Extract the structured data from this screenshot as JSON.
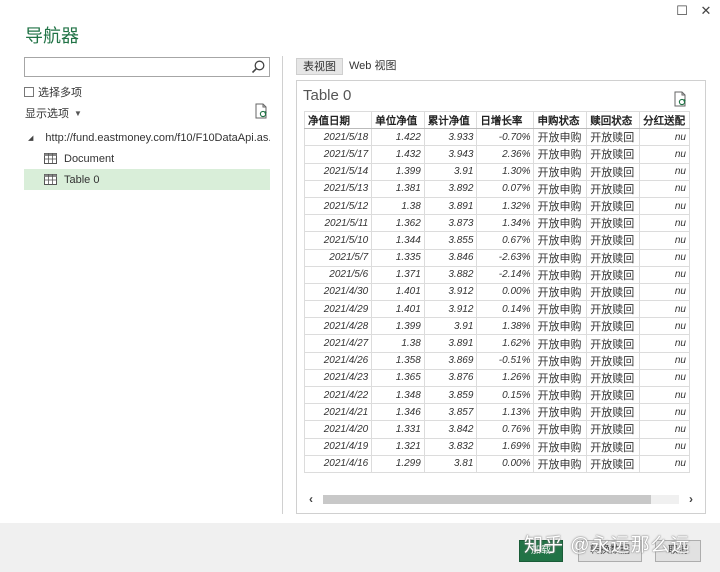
{
  "window": {
    "maximize_glyph": "☐",
    "close_glyph": "✕"
  },
  "title": "导航器",
  "search": {
    "value": "",
    "placeholder": ""
  },
  "select_multiple_label": "选择多项",
  "display_options_label": "显示选项",
  "tree": {
    "root_label": "http://fund.eastmoney.com/f10/F10DataApi.as...",
    "children": [
      {
        "label": "Document",
        "selected": false
      },
      {
        "label": "Table 0",
        "selected": true
      }
    ]
  },
  "tabs": [
    {
      "label": "表视图",
      "active": true
    },
    {
      "label": "Web 视图",
      "active": false
    }
  ],
  "preview": {
    "title": "Table 0",
    "columns": [
      "净值日期",
      "单位净值",
      "累计净值",
      "日增长率",
      "申购状态",
      "赎回状态",
      "分红送配"
    ],
    "rows": [
      [
        "2021/5/18",
        "1.422",
        "3.933",
        "-0.70%",
        "开放申购",
        "开放赎回",
        "nu"
      ],
      [
        "2021/5/17",
        "1.432",
        "3.943",
        "2.36%",
        "开放申购",
        "开放赎回",
        "nu"
      ],
      [
        "2021/5/14",
        "1.399",
        "3.91",
        "1.30%",
        "开放申购",
        "开放赎回",
        "nu"
      ],
      [
        "2021/5/13",
        "1.381",
        "3.892",
        "0.07%",
        "开放申购",
        "开放赎回",
        "nu"
      ],
      [
        "2021/5/12",
        "1.38",
        "3.891",
        "1.32%",
        "开放申购",
        "开放赎回",
        "nu"
      ],
      [
        "2021/5/11",
        "1.362",
        "3.873",
        "1.34%",
        "开放申购",
        "开放赎回",
        "nu"
      ],
      [
        "2021/5/10",
        "1.344",
        "3.855",
        "0.67%",
        "开放申购",
        "开放赎回",
        "nu"
      ],
      [
        "2021/5/7",
        "1.335",
        "3.846",
        "-2.63%",
        "开放申购",
        "开放赎回",
        "nu"
      ],
      [
        "2021/5/6",
        "1.371",
        "3.882",
        "-2.14%",
        "开放申购",
        "开放赎回",
        "nu"
      ],
      [
        "2021/4/30",
        "1.401",
        "3.912",
        "0.00%",
        "开放申购",
        "开放赎回",
        "nu"
      ],
      [
        "2021/4/29",
        "1.401",
        "3.912",
        "0.14%",
        "开放申购",
        "开放赎回",
        "nu"
      ],
      [
        "2021/4/28",
        "1.399",
        "3.91",
        "1.38%",
        "开放申购",
        "开放赎回",
        "nu"
      ],
      [
        "2021/4/27",
        "1.38",
        "3.891",
        "1.62%",
        "开放申购",
        "开放赎回",
        "nu"
      ],
      [
        "2021/4/26",
        "1.358",
        "3.869",
        "-0.51%",
        "开放申购",
        "开放赎回",
        "nu"
      ],
      [
        "2021/4/23",
        "1.365",
        "3.876",
        "1.26%",
        "开放申购",
        "开放赎回",
        "nu"
      ],
      [
        "2021/4/22",
        "1.348",
        "3.859",
        "0.15%",
        "开放申购",
        "开放赎回",
        "nu"
      ],
      [
        "2021/4/21",
        "1.346",
        "3.857",
        "1.13%",
        "开放申购",
        "开放赎回",
        "nu"
      ],
      [
        "2021/4/20",
        "1.331",
        "3.842",
        "0.76%",
        "开放申购",
        "开放赎回",
        "nu"
      ],
      [
        "2021/4/19",
        "1.321",
        "3.832",
        "1.69%",
        "开放申购",
        "开放赎回",
        "nu"
      ],
      [
        "2021/4/16",
        "1.299",
        "3.81",
        "0.00%",
        "开放申购",
        "开放赎回",
        "nu"
      ]
    ]
  },
  "scroll": {
    "left_glyph": "‹",
    "right_glyph": "›"
  },
  "footer": {
    "load_label": "加载",
    "transform_label": "转换数据",
    "cancel_label": "取消"
  },
  "watermark": "知乎 @永远那么远",
  "colors": {
    "accent": "#217346",
    "selected_bg": "#d9eed9"
  }
}
